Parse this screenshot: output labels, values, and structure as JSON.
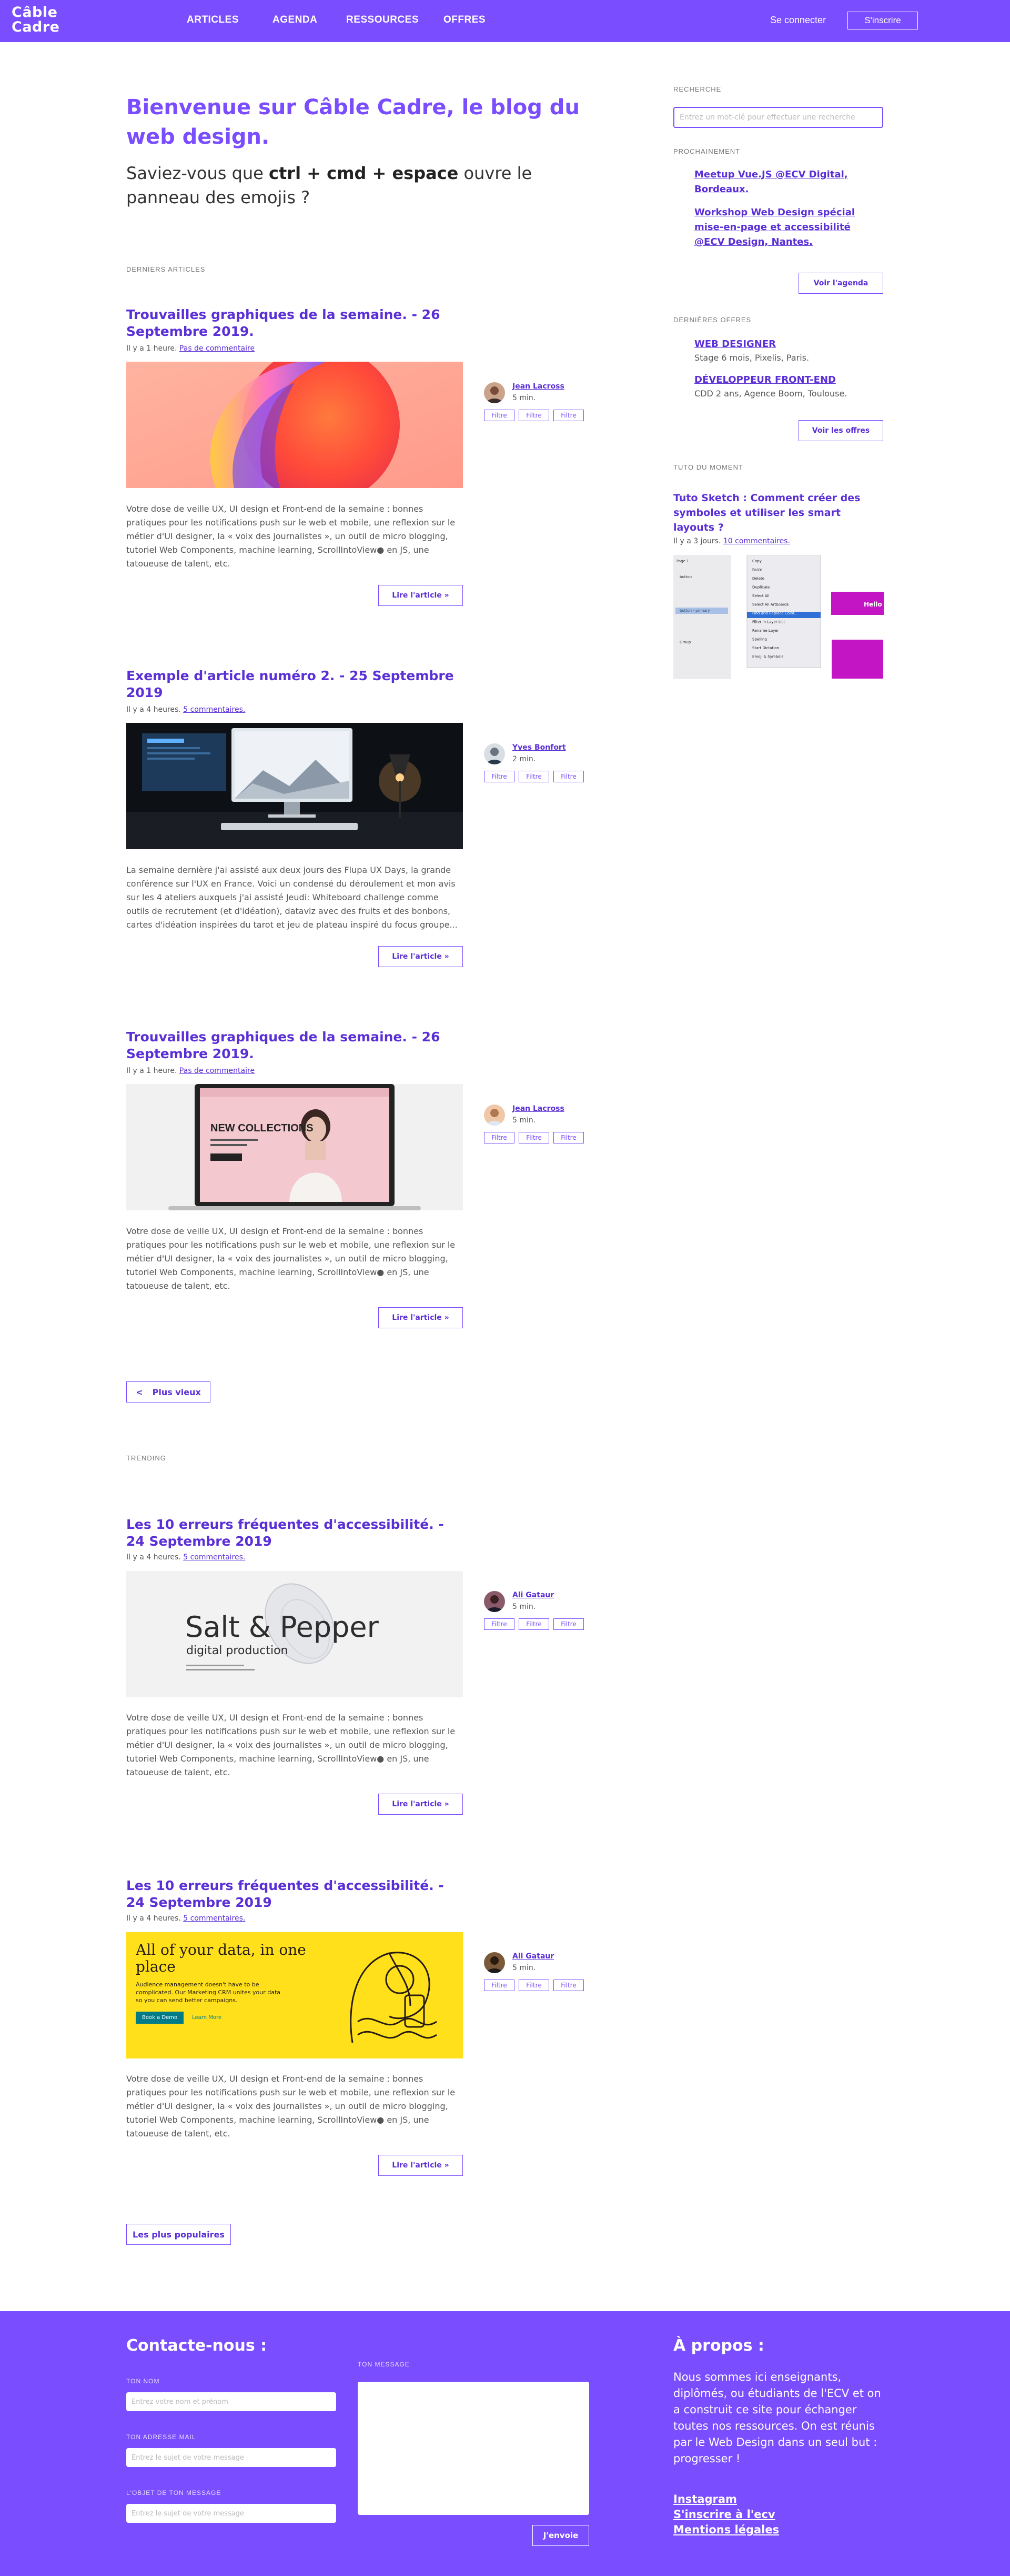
{
  "brand": {
    "line1": "Câble",
    "line2": "Cadre",
    "accent_color": "#7a4dff",
    "accent_dark": "#5a2fd6"
  },
  "nav": {
    "items": [
      "ARTICLES",
      "AGENDA",
      "RESSOURCES",
      "OFFRES"
    ],
    "login": "Se connecter",
    "signup": "S'inscrire"
  },
  "hero": {
    "title": "Bienvenue sur Câble Cadre, le blog du web design.",
    "tagline_before": "Saviez-vous que ",
    "tagline_keys": "ctrl + cmd + espace",
    "tagline_after": " ouvre le panneau des emojis ?"
  },
  "sections": {
    "latest": "DERNIERS ARTICLES",
    "trending": "TRENDING"
  },
  "filter_label": "Filtre",
  "read_more": "Lire l'article »",
  "articles": [
    {
      "title": "Trouvailles graphiques de la semaine. - 26 Septembre 2019.",
      "meta_prefix": "Il y a 1 heure. ",
      "meta_link": "Pas de commentaire",
      "image": "abstract-gradient-image",
      "author": "Jean Lacross",
      "read_time": "5 min.",
      "excerpt": "Votre dose de veille UX, UI design et Front-end de la semaine : bonnes pratiques pour les notifications push sur le web et mobile, une reflexion sur le métier d'UI designer, la « voix des journalistes », un outil de micro blogging, tutoriel Web Components, machine learning, ScrollIntoView● en JS, une tatoueuse de talent, etc."
    },
    {
      "title": "Exemple d'article numéro 2. - 25 Septembre 2019",
      "meta_prefix": "Il y a 4 heures. ",
      "meta_link": "5 commentaires.",
      "image": "desk-computer-image",
      "author": "Yves Bonfort",
      "read_time": "2 min.",
      "excerpt": "La semaine dernière j'ai assisté aux deux jours des Flupa UX Days, la grande conférence sur l'UX en France. Voici un condensé du déroulement et mon avis sur les 4 ateliers auxquels j'ai assisté Jeudi: Whiteboard challenge comme outils de recrutement (et d'idéation), dataviz avec des fruits et des bonbons, cartes d'idéation inspirées du tarot et jeu de plateau inspiré du focus groupe..."
    },
    {
      "title": "Trouvailles graphiques de la semaine. - 26 Septembre 2019.",
      "meta_prefix": "Il y a 1 heure. ",
      "meta_link": "Pas de commentaire",
      "image": "laptop-fashion-image",
      "image_text": "NEW COLLECTIONS",
      "author": "Jean Lacross",
      "read_time": "5 min.",
      "excerpt": "Votre dose de veille UX, UI design et Front-end de la semaine : bonnes pratiques pour les notifications push sur le web et mobile, une reflexion sur le métier d'UI designer, la « voix des journalistes », un outil de micro blogging, tutoriel Web Components, machine learning, ScrollIntoView● en JS, une tatoueuse de talent, etc."
    }
  ],
  "older_button": {
    "arrow": "<",
    "label": "Plus vieux"
  },
  "trending": [
    {
      "title": "Les 10 erreurs fréquentes d'accessibilité. - 24 Septembre 2019",
      "meta_prefix": "Il y a 4 heures. ",
      "meta_link": "5 commentaires.",
      "image": "salt-pepper-image",
      "image_title": "Salt & Pepper",
      "image_subtitle": "digital production",
      "author": "Ali Gataur",
      "read_time": "5 min.",
      "excerpt": "Votre dose de veille UX, UI design et Front-end de la semaine : bonnes pratiques pour les notifications push sur le web et mobile, une reflexion sur le métier d'UI designer, la « voix des journalistes », un outil de micro blogging, tutoriel Web Components, machine learning, ScrollIntoView● en JS, une tatoueuse de talent, etc."
    },
    {
      "title": "Les 10 erreurs fréquentes d'accessibilité. - 24 Septembre 2019",
      "meta_prefix": "Il y a 4 heures. ",
      "meta_link": "5 commentaires.",
      "image": "yellow-crm-image",
      "image_title": "All of your data, in one place",
      "image_body": "Audience management doesn't have to be complicated. Our Marketing CRM unites your data so you can send better campaigns.",
      "image_button": "Book a Demo",
      "image_link": "Learn More",
      "author": "Ali Gataur",
      "read_time": "5 min.",
      "excerpt": "Votre dose de veille UX, UI design et Front-end de la semaine : bonnes pratiques pour les notifications push sur le web et mobile, une reflexion sur le métier d'UI designer, la « voix des journalistes », un outil de micro blogging, tutoriel Web Components, machine learning, ScrollIntoView● en JS, une tatoueuse de talent, etc."
    }
  ],
  "popular_button": "Les plus populaires",
  "sidebar": {
    "search_label": "RECHERCHE",
    "search_placeholder": "Entrez un mot-clé pour effectuer une recherche",
    "upcoming_label": "PROCHAINEMENT",
    "events": [
      "Meetup Vue.JS @ECV Digital, Bordeaux.",
      "Workshop Web Design spécial mise-en-page et accessibilité @ECV Design, Nantes."
    ],
    "agenda_button": "Voir l'agenda",
    "offers_label": "DERNIÈRES OFFRES",
    "offers": [
      {
        "title": "WEB DESIGNER",
        "detail": "Stage 6 mois, Pixelis, Paris."
      },
      {
        "title": "DÉVELOPPEUR FRONT-END",
        "detail": "CDD 2 ans, Agence Boom, Toulouse."
      }
    ],
    "offers_button": "Voir les offres",
    "tuto_label": "TUTO DU MOMENT",
    "tuto_title": "Tuto Sketch : Comment créer des symboles et utiliser les smart layouts ?",
    "tuto_meta_prefix": "Il y a 3 jours. ",
    "tuto_meta_link": "10 commentaires.",
    "tuto_menu": [
      "Copy",
      "Paste",
      "Delete",
      "Duplicate",
      "Select All",
      "Select All Artboards",
      "Find and Replace Color...",
      "Filter in Layer List",
      "Rename Layer",
      "Spelling",
      "Start Dictation",
      "Emoji & Symbols"
    ],
    "tuto_layers": [
      "Page 1",
      "button",
      "button - primary",
      "Group"
    ],
    "tuto_badge": "Hello"
  },
  "footer": {
    "contact_heading": "Contacte-nous :",
    "name_label": "TON NOM",
    "name_placeholder": "Entrez votre nom et prénom",
    "email_label": "TON ADRESSE MAIL",
    "email_placeholder": "Entrez le sujet de votre message",
    "subject_label": "L'OBJET DE TON MESSAGE",
    "subject_placeholder": "Entrez le sujet de votre message",
    "message_label": "TON MESSAGE",
    "submit": "J'envoie",
    "about_heading": "À propos :",
    "about_text": "Nous sommes ici enseignants, diplômés, ou étudiants de l'ECV et on a construit ce site pour échanger toutes nos ressources. On est réunis par le Web Design dans un seul but : progresser !",
    "links": [
      "Instagram",
      "S'inscrire à l'ecv",
      "Mentions légales"
    ]
  }
}
